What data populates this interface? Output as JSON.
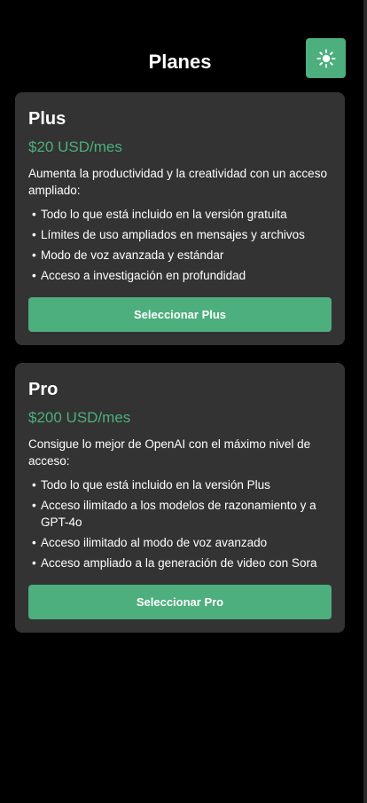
{
  "header": {
    "title": "Planes",
    "theme_toggle_icon": "sun-icon"
  },
  "colors": {
    "accent": "#4caf7d",
    "card_background": "#333333",
    "page_background": "#000000"
  },
  "plans": [
    {
      "name": "Plus",
      "price": "$20 USD/mes",
      "description": "Aumenta la productividad y la creatividad con un acceso ampliado:",
      "features": [
        "Todo lo que está incluido en la versión gratuita",
        "Límites de uso ampliados en mensajes y archivos",
        "Modo de voz avanzada y estándar",
        "Acceso a investigación en profundidad"
      ],
      "button_label": "Seleccionar Plus"
    },
    {
      "name": "Pro",
      "price": "$200 USD/mes",
      "description": "Consigue lo mejor de OpenAI con el máximo nivel de acceso:",
      "features": [
        "Todo lo que está incluido en la versión Plus",
        "Acceso ilimitado a los modelos de razonamiento y a GPT-4o",
        "Acceso ilimitado al modo de voz avanzado",
        "Acceso ampliado a la generación de video con Sora"
      ],
      "button_label": "Seleccionar Pro"
    }
  ]
}
